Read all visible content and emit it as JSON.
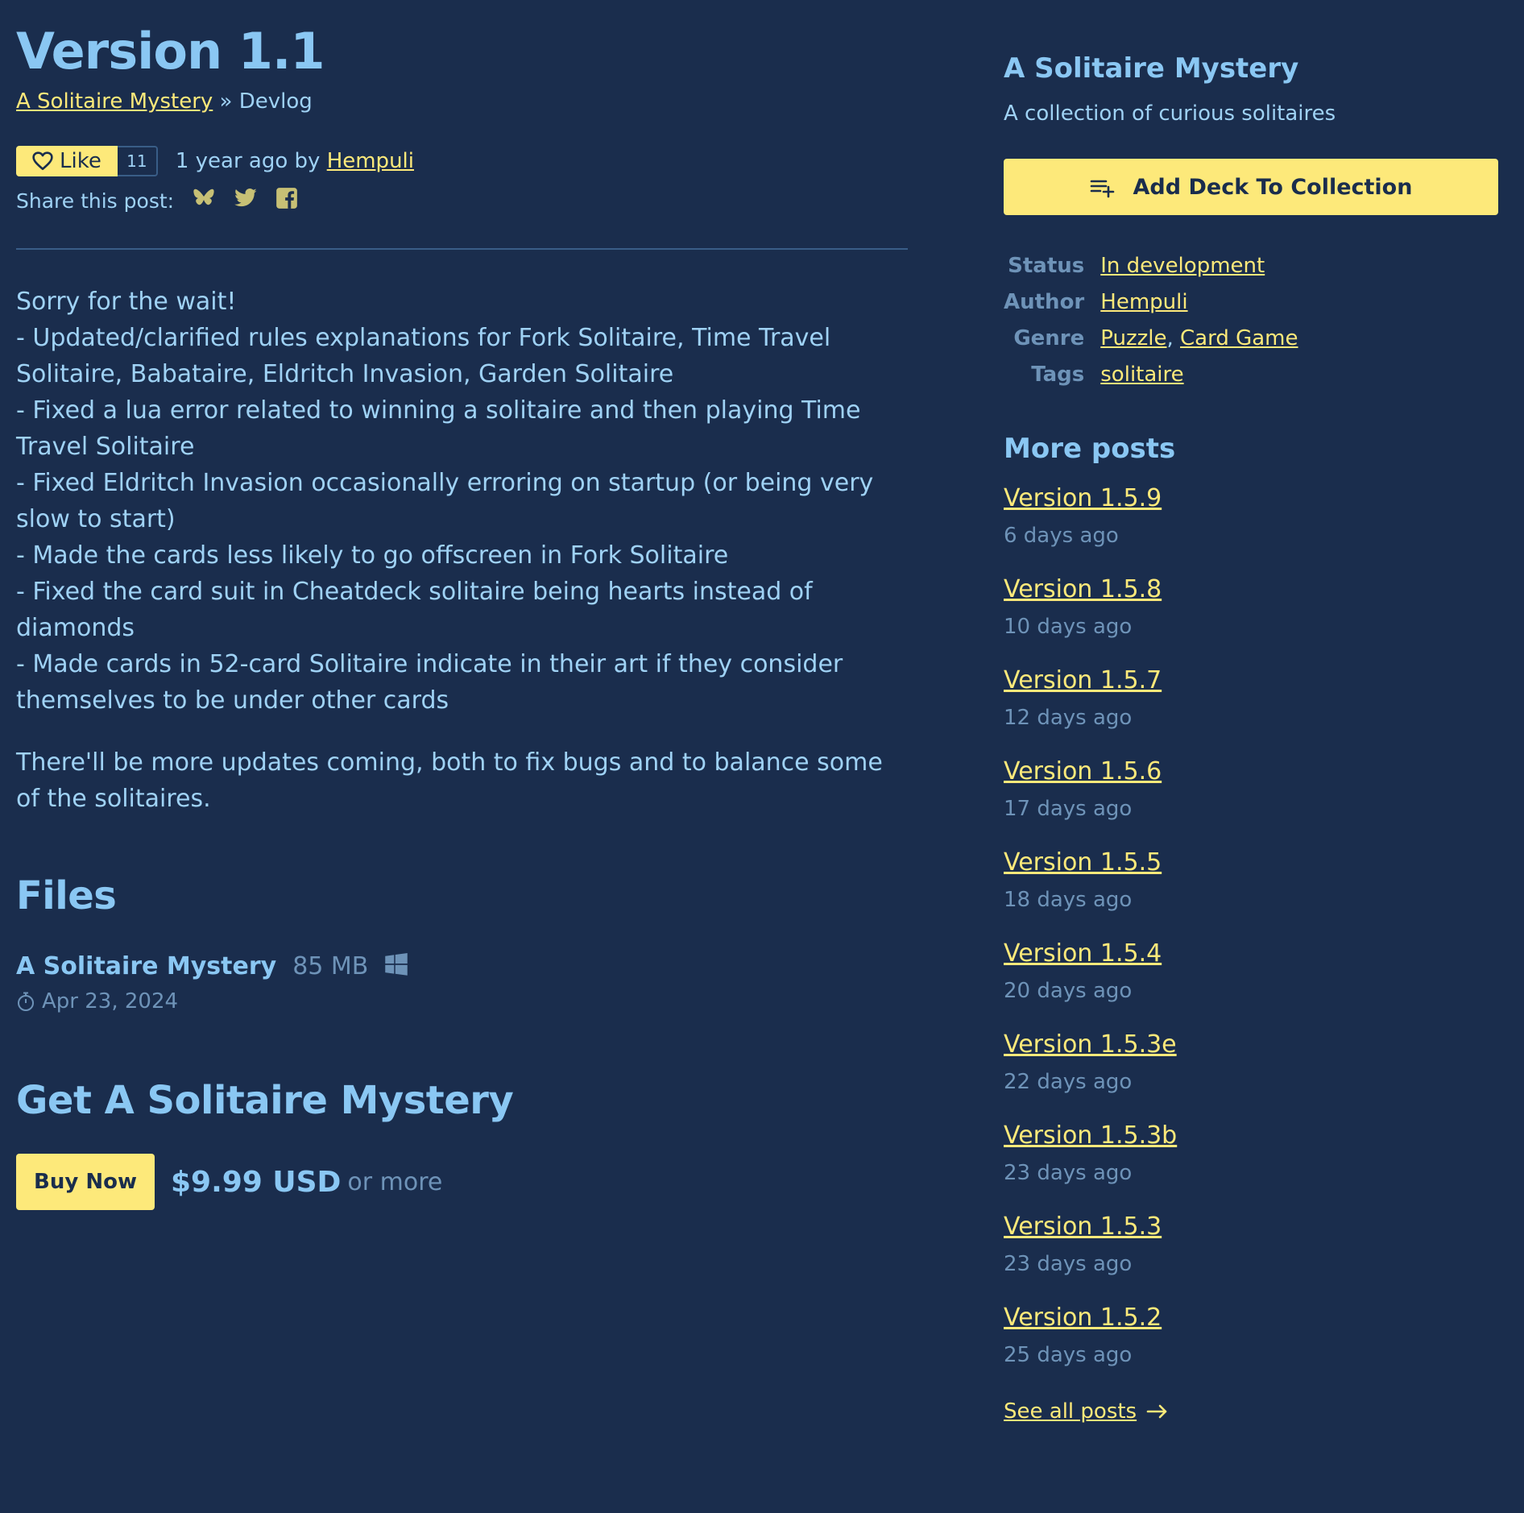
{
  "post": {
    "title": "Version 1.1",
    "breadcrumb_link": "A Solitaire Mystery",
    "breadcrumb_rest": " » Devlog",
    "like_label": "Like",
    "like_count": "11",
    "date_prefix": "1 year ago by ",
    "author": "Hempuli",
    "share_label": "Share this post:",
    "share_icons": [
      "bluesky-icon",
      "twitter-icon",
      "facebook-icon"
    ],
    "body": [
      "Sorry for the wait!",
      "- Updated/clarified rules explanations for Fork Solitaire, Time Travel Solitaire, Babataire, Eldritch Invasion, Garden Solitaire",
      "- Fixed a lua error related to winning a solitaire and then playing Time Travel Solitaire",
      "- Fixed Eldritch Invasion occasionally erroring on startup (or being very slow to start)",
      "- Made the cards less likely to go offscreen in Fork Solitaire",
      "- Fixed the card suit in Cheatdeck solitaire being hearts instead of diamonds",
      "- Made cards in 52-card Solitaire indicate in their art if they consider themselves to be under other cards"
    ],
    "closing": "There'll be more updates coming, both to fix bugs and to balance some of the solitaires."
  },
  "files": {
    "title": "Files",
    "name": "A Solitaire Mystery",
    "size": "85 MB",
    "platform_icon": "windows-icon",
    "date": "Apr 23, 2024"
  },
  "purchase": {
    "title": "Get A Solitaire Mystery",
    "buy_label": "Buy Now",
    "price": "$9.99 USD",
    "or_more": "or more"
  },
  "sidebar": {
    "game_title": "A Solitaire Mystery",
    "tagline": "A collection of curious solitaires",
    "collection_button": "Add Deck To Collection",
    "info": {
      "status_label": "Status",
      "status_value": "In development",
      "author_label": "Author",
      "author_value": "Hempuli",
      "genre_label": "Genre",
      "genre_values": [
        "Puzzle",
        "Card Game"
      ],
      "genre_sep": ", ",
      "tags_label": "Tags",
      "tags_value": "solitaire"
    },
    "more_posts_title": "More posts",
    "posts": [
      {
        "title": "Version 1.5.9",
        "ago": "6 days ago"
      },
      {
        "title": "Version 1.5.8",
        "ago": "10 days ago"
      },
      {
        "title": "Version 1.5.7",
        "ago": "12 days ago"
      },
      {
        "title": "Version 1.5.6",
        "ago": "17 days ago"
      },
      {
        "title": "Version 1.5.5",
        "ago": "18 days ago"
      },
      {
        "title": "Version 1.5.4",
        "ago": "20 days ago"
      },
      {
        "title": "Version 1.5.3e",
        "ago": "22 days ago"
      },
      {
        "title": "Version 1.5.3b",
        "ago": "23 days ago"
      },
      {
        "title": "Version 1.5.3",
        "ago": "23 days ago"
      },
      {
        "title": "Version 1.5.2",
        "ago": "25 days ago"
      }
    ],
    "see_all": "See all posts"
  },
  "colors": {
    "background": "#1a2d4d",
    "text": "#9fd2f5",
    "heading": "#8ac7f3",
    "accent_yellow": "#fde97a",
    "muted": "#6e93b8"
  }
}
